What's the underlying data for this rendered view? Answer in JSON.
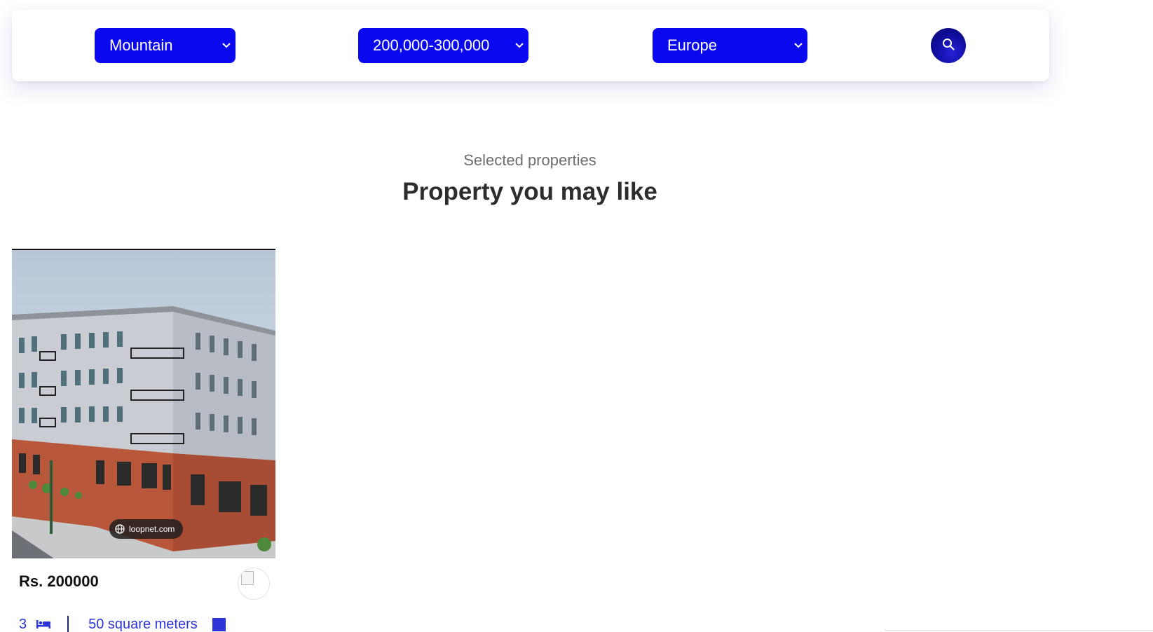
{
  "search": {
    "type_value": "Mountain",
    "price_value": "200,000-300,000",
    "region_value": "Europe",
    "search_icon": "search-icon"
  },
  "section": {
    "subtitle": "Selected properties",
    "title": "Property you may like"
  },
  "listing": {
    "price": "Rs. 200000",
    "bedrooms": "3",
    "area": "50 square meters",
    "image_watermark": "loopnet.com",
    "bed_icon": "bed-icon",
    "area_icon": "area-icon",
    "avatar_icon": "broken-image-icon"
  },
  "colors": {
    "accent": "#0a08ee",
    "stat_text": "#2c34d8",
    "search_button": "#0f0d9a"
  }
}
